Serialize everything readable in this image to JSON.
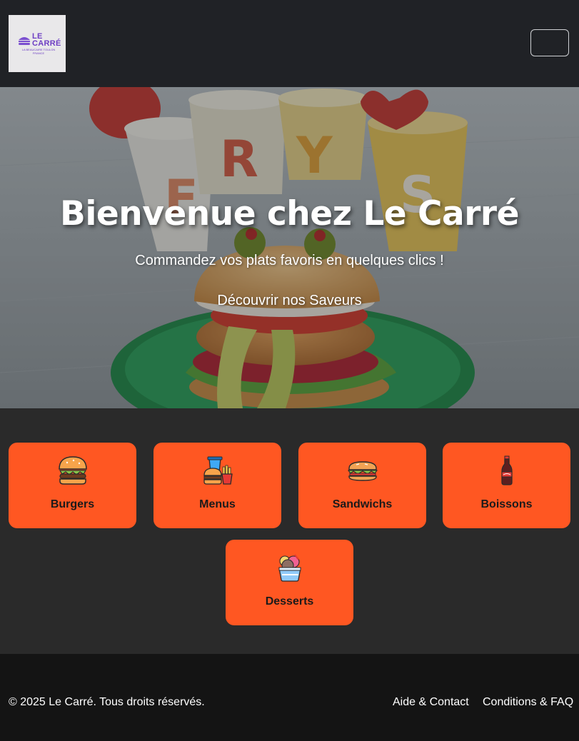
{
  "header": {
    "logo": {
      "name": "LE CARRÉ",
      "line1": "LE",
      "line2": "CARRÉ",
      "sub1": "LA BEAUCAIRE TOULON",
      "sub2": "FRANCE"
    },
    "menu_toggle_icon": "hamburger-icon"
  },
  "hero": {
    "title": "Bienvenue chez Le Carré",
    "subtitle": "Commandez vos plats favoris en quelques clics !",
    "cta": "Découvrir nos Saveurs"
  },
  "categories": [
    {
      "label": "Burgers",
      "icon": "burger-icon"
    },
    {
      "label": "Menus",
      "icon": "menu-combo-icon"
    },
    {
      "label": "Sandwichs",
      "icon": "sandwich-icon"
    },
    {
      "label": "Boissons",
      "icon": "soda-bottle-icon"
    },
    {
      "label": "Desserts",
      "icon": "ice-cream-icon"
    }
  ],
  "footer": {
    "copyright": "© 2025 Le Carré. Tous droits réservés.",
    "links": [
      "Aide & Contact",
      "Conditions & FAQ"
    ]
  },
  "colors": {
    "accent": "#ff5722",
    "header_bg": "#202226",
    "section_bg": "#2a2a2a",
    "footer_bg": "#141414",
    "logo_purple": "#6e3fc4"
  }
}
